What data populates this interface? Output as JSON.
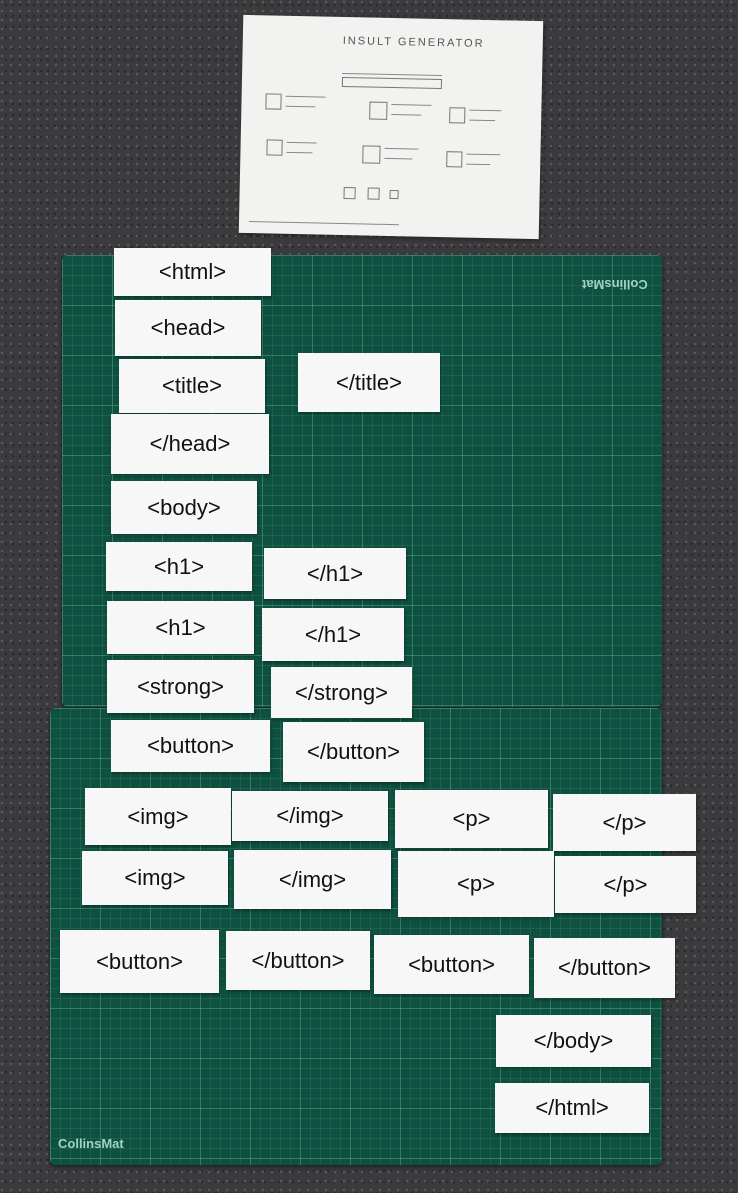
{
  "sketch": {
    "title": "INSULT GENERATOR"
  },
  "mat": {
    "brand": "CollinsMat"
  },
  "cards": {
    "html_open": "<html>",
    "head_open": "<head>",
    "title_open": "<title>",
    "title_close": "</title>",
    "head_close": "</head>",
    "body_open": "<body>",
    "h1_open_1": "<h1>",
    "h1_close_1": "</h1>",
    "h1_open_2": "<h1>",
    "h1_close_2": "</h1>",
    "strong_open": "<strong>",
    "strong_close": "</strong>",
    "button_open_1": "<button>",
    "button_close_1": "</button>",
    "img_open_1": "<img>",
    "img_close_1": "</img>",
    "p_open_1": "<p>",
    "p_close_1": "</p>",
    "img_open_2": "<img>",
    "img_close_2": "</img>",
    "p_open_2": "<p>",
    "p_close_2": "</p>",
    "button_open_2": "<button>",
    "button_close_2": "</button>",
    "button_open_3": "<button>",
    "button_close_3": "</button>",
    "body_close": "</body>",
    "html_close": "</html>"
  }
}
